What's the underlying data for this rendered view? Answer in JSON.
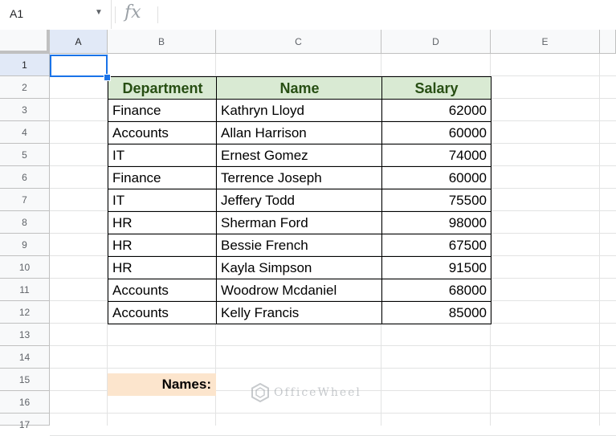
{
  "namebox": {
    "value": "A1"
  },
  "formula": {
    "fx_label": "fx",
    "content": ""
  },
  "columns": [
    "A",
    "B",
    "C",
    "D",
    "E"
  ],
  "rows": [
    "1",
    "2",
    "3",
    "4",
    "5",
    "6",
    "7",
    "8",
    "9",
    "10",
    "11",
    "12",
    "13",
    "14",
    "15",
    "16",
    "17"
  ],
  "table": {
    "headers": [
      "Department",
      "Name",
      "Salary"
    ],
    "rows": [
      [
        "Finance",
        "Kathryn Lloyd",
        "62000"
      ],
      [
        "Accounts",
        "Allan Harrison",
        "60000"
      ],
      [
        "IT",
        "Ernest Gomez",
        "74000"
      ],
      [
        "Finance",
        "Terrence Joseph",
        "60000"
      ],
      [
        "IT",
        "Jeffery Todd",
        "75500"
      ],
      [
        "HR",
        "Sherman Ford",
        "98000"
      ],
      [
        "HR",
        "Bessie French",
        "67500"
      ],
      [
        "HR",
        "Kayla Simpson",
        "91500"
      ],
      [
        "Accounts",
        "Woodrow Mcdaniel",
        "68000"
      ],
      [
        "Accounts",
        "Kelly Francis",
        "85000"
      ]
    ]
  },
  "names_label": "Names:",
  "watermark": "OfficeWheel",
  "colors": {
    "header_fill": "#d9ead3",
    "header_text": "#274e13",
    "names_fill": "#fce5cd",
    "selection": "#1a73e8"
  }
}
